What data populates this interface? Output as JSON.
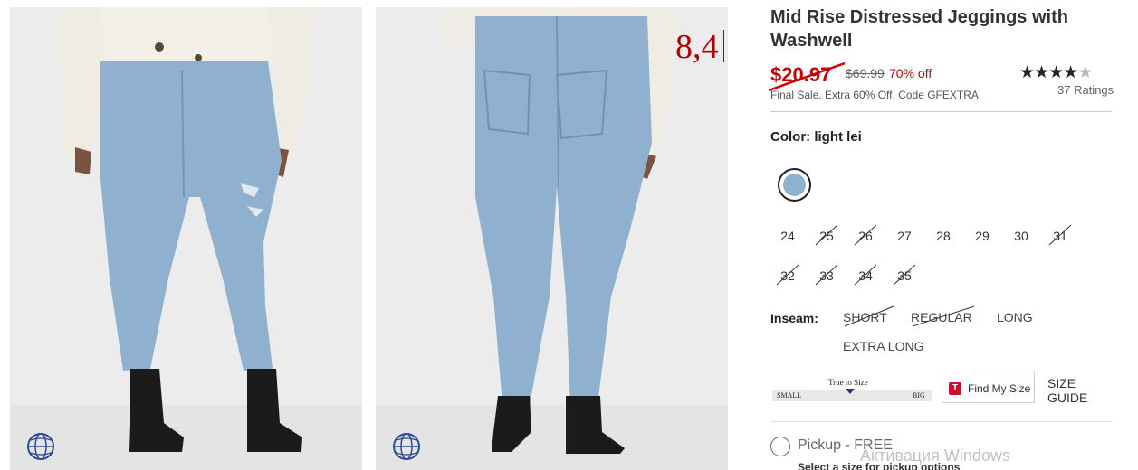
{
  "product": {
    "title": "Mid Rise Distressed Jeggings with Washwell",
    "sale_price": "$20.97",
    "original_price": "$69.99",
    "discount": "70% off",
    "promo": "Final Sale. Extra 60% Off. Code GFEXTRA",
    "rating": 4.5,
    "ratings_count": "37 Ratings"
  },
  "annotation": "8,4",
  "color": {
    "label": "Color: light lei",
    "swatch_hex": "#8fb1cf"
  },
  "sizes": [
    {
      "label": "24",
      "available": true
    },
    {
      "label": "25",
      "available": false
    },
    {
      "label": "26",
      "available": false
    },
    {
      "label": "27",
      "available": true
    },
    {
      "label": "28",
      "available": true
    },
    {
      "label": "29",
      "available": true
    },
    {
      "label": "30",
      "available": true
    },
    {
      "label": "31",
      "available": false
    },
    {
      "label": "32",
      "available": false
    },
    {
      "label": "33",
      "available": false
    },
    {
      "label": "34",
      "available": false
    },
    {
      "label": "35",
      "available": false
    }
  ],
  "inseam": {
    "label": "Inseam:",
    "options": [
      {
        "label": "SHORT",
        "available": false
      },
      {
        "label": "REGULAR",
        "available": false
      },
      {
        "label": "LONG",
        "available": true
      },
      {
        "label": "EXTRA LONG",
        "available": true
      }
    ]
  },
  "fit": {
    "true_to_size": "True to Size",
    "small": "SMALL",
    "big": "BIG"
  },
  "find_my_size": "Find My Size",
  "size_guide": "SIZE GUIDE",
  "pickup": {
    "label": "Pickup - FREE",
    "note": "Select a size for pickup options"
  },
  "watermark": "Активация Windows",
  "colors": {
    "sale": "#cc0000",
    "denim": "#8fb1cf",
    "brand_red": "#c4122f"
  },
  "icons": [
    "360-spin-icon",
    "star-icon",
    "radio-icon"
  ]
}
